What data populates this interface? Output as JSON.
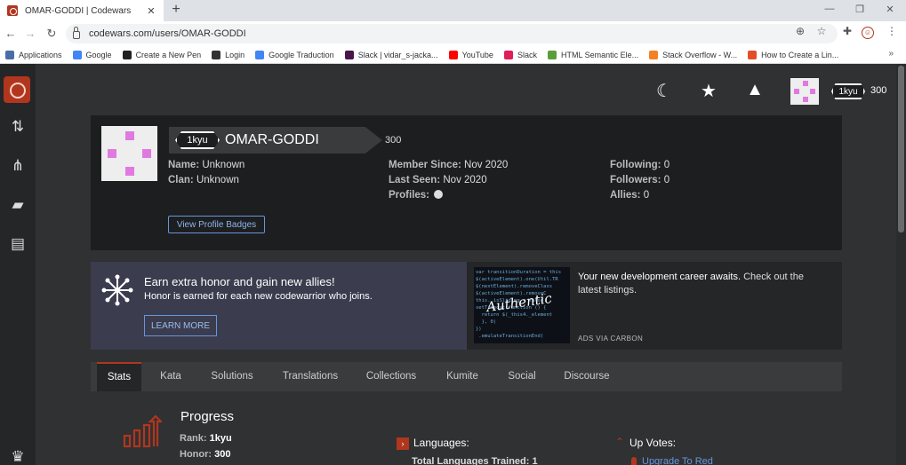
{
  "browser": {
    "tab_title": "OMAR-GODDI | Codewars",
    "tab_close": "✕",
    "new_tab": "+",
    "url": "codewars.com/users/OMAR-GODDI",
    "window": {
      "minimize": "—",
      "restore": "❐",
      "close": "✕"
    },
    "nav": {
      "back": "←",
      "forward": "→",
      "reload": "↻"
    },
    "bookmarks": [
      {
        "label": "Applications",
        "color": "#4a6da7"
      },
      {
        "label": "Google",
        "color": "#4285f4"
      },
      {
        "label": "Create a New Pen",
        "color": "#222222"
      },
      {
        "label": "Login",
        "color": "#333333"
      },
      {
        "label": "Google Traduction",
        "color": "#4285f4"
      },
      {
        "label": "Slack | vidar_s-jacka...",
        "color": "#4a154b"
      },
      {
        "label": "YouTube",
        "color": "#ff0000"
      },
      {
        "label": "Slack",
        "color": "#e01e5a"
      },
      {
        "label": "HTML Semantic Ele...",
        "color": "#5a9e3a"
      },
      {
        "label": "Stack Overflow - W...",
        "color": "#f48024"
      },
      {
        "label": "How to Create a Lin...",
        "color": "#e44d26"
      }
    ],
    "bookmarks_more": "»"
  },
  "header": {
    "rank": "1kyu",
    "honor": "300"
  },
  "profile": {
    "rank": "1kyu",
    "username": "OMAR-GODDI",
    "honor": "300",
    "name_label": "Name:",
    "name": "Unknown",
    "clan_label": "Clan:",
    "clan": "Unknown",
    "member_since_label": "Member Since:",
    "member_since": "Nov 2020",
    "last_seen_label": "Last Seen:",
    "last_seen": "Nov 2020",
    "profiles_label": "Profiles:",
    "following_label": "Following:",
    "following": "0",
    "followers_label": "Followers:",
    "followers": "0",
    "allies_label": "Allies:",
    "allies": "0",
    "badges_button": "View Profile Badges"
  },
  "promo": {
    "title": "Earn extra honor and gain new allies!",
    "subtitle": "Honor is earned for each new codewarrior who joins.",
    "button": "LEARN MORE"
  },
  "ad": {
    "headline": "Your new development career awaits.",
    "body": " Check out the latest listings.",
    "via": "ADS VIA CARBON",
    "image_script": "Authentic"
  },
  "tabs": [
    "Stats",
    "Kata",
    "Solutions",
    "Translations",
    "Collections",
    "Kumite",
    "Social",
    "Discourse"
  ],
  "stats": {
    "progress_title": "Progress",
    "rank_label": "Rank:",
    "rank": "1kyu",
    "honor_label": "Honor:",
    "honor": "300",
    "languages_title": "Languages:",
    "languages_total": "Total Languages Trained: 1",
    "upvotes_title": "Up Votes:",
    "upgrade_link": "Upgrade To Red"
  },
  "colors": {
    "brand": "#b1361e",
    "accent_link": "#6795de",
    "avatar_pink": "#e07ae0"
  }
}
